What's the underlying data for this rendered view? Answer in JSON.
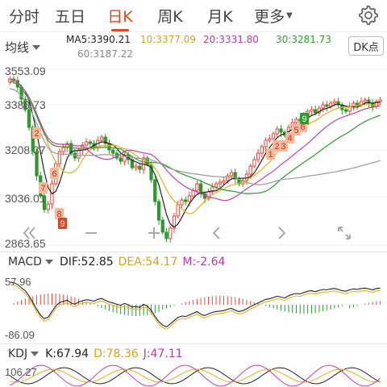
{
  "tabs": [
    {
      "label": "分时",
      "active": false
    },
    {
      "label": "五日",
      "active": false
    },
    {
      "label": "日K",
      "active": true
    },
    {
      "label": "周K",
      "active": false
    },
    {
      "label": "月K",
      "active": false
    }
  ],
  "more_label": "更多",
  "settings_icon": "gear-icon",
  "ma_legend": {
    "selector_label": "均线",
    "ma5": {
      "label": "MA5:3390.21",
      "color": "#222222"
    },
    "ma10": {
      "label": "10:3377.09",
      "color": "#e0b020"
    },
    "ma20": {
      "label": "20:3331.80",
      "color": "#c040b0"
    },
    "ma30": {
      "label": "30:3281.73",
      "color": "#2e9a2e"
    },
    "ma60": {
      "label": "60:3187.22",
      "color": "#888888"
    },
    "dk_label": "DK点"
  },
  "price_axis": {
    "high": "3553.09",
    "p2": "3380.73",
    "p3": "3208.37",
    "p4": "3036.01",
    "low": "2863.65"
  },
  "markers": [
    "2",
    "6",
    "7",
    "8",
    "9",
    "1",
    "2",
    "3",
    "4",
    "5",
    "6",
    "9"
  ],
  "zoom_controls": [
    "double-chevron-left-icon",
    "minus-icon",
    "plus-icon",
    "chevron-left-icon",
    "chevron-right-icon",
    "expand-icon"
  ],
  "macd": {
    "name": "MACD",
    "dif": "DIF:52.85",
    "dea": "DEA:54.17",
    "m": "M:-2.64",
    "top": "57.96",
    "bottom": "-86.09",
    "colors": {
      "dif": "#222222",
      "dea": "#e0b020",
      "m": "#c040b0"
    }
  },
  "kdj": {
    "name": "KDJ",
    "k": "K:67.94",
    "d": "D:78.36",
    "j": "J:47.11",
    "top": "106.27",
    "colors": {
      "k": "#222222",
      "d": "#e0b020",
      "j": "#c040b0"
    }
  },
  "colors": {
    "up": "#e84a3a",
    "down": "#2e9a2e",
    "accent": "#e04a28"
  }
}
